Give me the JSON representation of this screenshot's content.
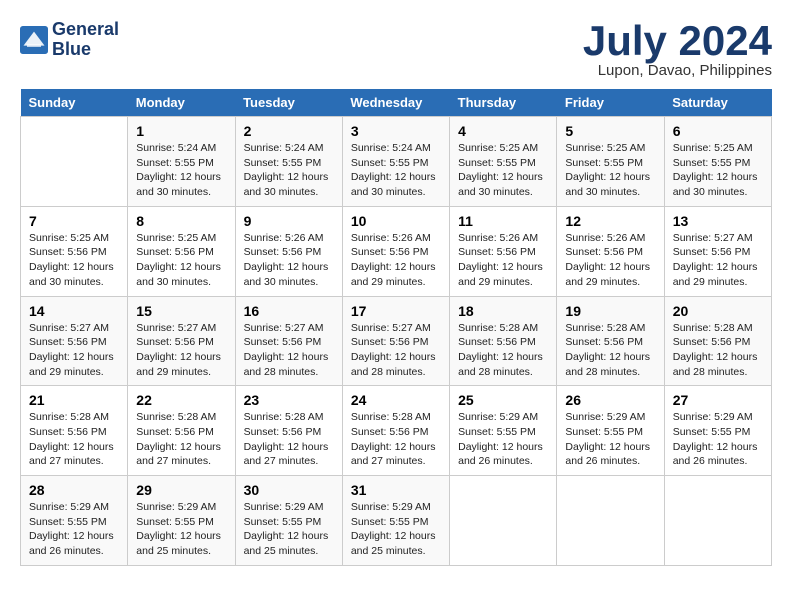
{
  "header": {
    "logo_line1": "General",
    "logo_line2": "Blue",
    "month_year": "July 2024",
    "location": "Lupon, Davao, Philippines"
  },
  "weekdays": [
    "Sunday",
    "Monday",
    "Tuesday",
    "Wednesday",
    "Thursday",
    "Friday",
    "Saturday"
  ],
  "weeks": [
    [
      {
        "day": "",
        "info": ""
      },
      {
        "day": "1",
        "info": "Sunrise: 5:24 AM\nSunset: 5:55 PM\nDaylight: 12 hours\nand 30 minutes."
      },
      {
        "day": "2",
        "info": "Sunrise: 5:24 AM\nSunset: 5:55 PM\nDaylight: 12 hours\nand 30 minutes."
      },
      {
        "day": "3",
        "info": "Sunrise: 5:24 AM\nSunset: 5:55 PM\nDaylight: 12 hours\nand 30 minutes."
      },
      {
        "day": "4",
        "info": "Sunrise: 5:25 AM\nSunset: 5:55 PM\nDaylight: 12 hours\nand 30 minutes."
      },
      {
        "day": "5",
        "info": "Sunrise: 5:25 AM\nSunset: 5:55 PM\nDaylight: 12 hours\nand 30 minutes."
      },
      {
        "day": "6",
        "info": "Sunrise: 5:25 AM\nSunset: 5:55 PM\nDaylight: 12 hours\nand 30 minutes."
      }
    ],
    [
      {
        "day": "7",
        "info": "Sunrise: 5:25 AM\nSunset: 5:56 PM\nDaylight: 12 hours\nand 30 minutes."
      },
      {
        "day": "8",
        "info": "Sunrise: 5:25 AM\nSunset: 5:56 PM\nDaylight: 12 hours\nand 30 minutes."
      },
      {
        "day": "9",
        "info": "Sunrise: 5:26 AM\nSunset: 5:56 PM\nDaylight: 12 hours\nand 30 minutes."
      },
      {
        "day": "10",
        "info": "Sunrise: 5:26 AM\nSunset: 5:56 PM\nDaylight: 12 hours\nand 29 minutes."
      },
      {
        "day": "11",
        "info": "Sunrise: 5:26 AM\nSunset: 5:56 PM\nDaylight: 12 hours\nand 29 minutes."
      },
      {
        "day": "12",
        "info": "Sunrise: 5:26 AM\nSunset: 5:56 PM\nDaylight: 12 hours\nand 29 minutes."
      },
      {
        "day": "13",
        "info": "Sunrise: 5:27 AM\nSunset: 5:56 PM\nDaylight: 12 hours\nand 29 minutes."
      }
    ],
    [
      {
        "day": "14",
        "info": "Sunrise: 5:27 AM\nSunset: 5:56 PM\nDaylight: 12 hours\nand 29 minutes."
      },
      {
        "day": "15",
        "info": "Sunrise: 5:27 AM\nSunset: 5:56 PM\nDaylight: 12 hours\nand 29 minutes."
      },
      {
        "day": "16",
        "info": "Sunrise: 5:27 AM\nSunset: 5:56 PM\nDaylight: 12 hours\nand 28 minutes."
      },
      {
        "day": "17",
        "info": "Sunrise: 5:27 AM\nSunset: 5:56 PM\nDaylight: 12 hours\nand 28 minutes."
      },
      {
        "day": "18",
        "info": "Sunrise: 5:28 AM\nSunset: 5:56 PM\nDaylight: 12 hours\nand 28 minutes."
      },
      {
        "day": "19",
        "info": "Sunrise: 5:28 AM\nSunset: 5:56 PM\nDaylight: 12 hours\nand 28 minutes."
      },
      {
        "day": "20",
        "info": "Sunrise: 5:28 AM\nSunset: 5:56 PM\nDaylight: 12 hours\nand 28 minutes."
      }
    ],
    [
      {
        "day": "21",
        "info": "Sunrise: 5:28 AM\nSunset: 5:56 PM\nDaylight: 12 hours\nand 27 minutes."
      },
      {
        "day": "22",
        "info": "Sunrise: 5:28 AM\nSunset: 5:56 PM\nDaylight: 12 hours\nand 27 minutes."
      },
      {
        "day": "23",
        "info": "Sunrise: 5:28 AM\nSunset: 5:56 PM\nDaylight: 12 hours\nand 27 minutes."
      },
      {
        "day": "24",
        "info": "Sunrise: 5:28 AM\nSunset: 5:56 PM\nDaylight: 12 hours\nand 27 minutes."
      },
      {
        "day": "25",
        "info": "Sunrise: 5:29 AM\nSunset: 5:55 PM\nDaylight: 12 hours\nand 26 minutes."
      },
      {
        "day": "26",
        "info": "Sunrise: 5:29 AM\nSunset: 5:55 PM\nDaylight: 12 hours\nand 26 minutes."
      },
      {
        "day": "27",
        "info": "Sunrise: 5:29 AM\nSunset: 5:55 PM\nDaylight: 12 hours\nand 26 minutes."
      }
    ],
    [
      {
        "day": "28",
        "info": "Sunrise: 5:29 AM\nSunset: 5:55 PM\nDaylight: 12 hours\nand 26 minutes."
      },
      {
        "day": "29",
        "info": "Sunrise: 5:29 AM\nSunset: 5:55 PM\nDaylight: 12 hours\nand 25 minutes."
      },
      {
        "day": "30",
        "info": "Sunrise: 5:29 AM\nSunset: 5:55 PM\nDaylight: 12 hours\nand 25 minutes."
      },
      {
        "day": "31",
        "info": "Sunrise: 5:29 AM\nSunset: 5:55 PM\nDaylight: 12 hours\nand 25 minutes."
      },
      {
        "day": "",
        "info": ""
      },
      {
        "day": "",
        "info": ""
      },
      {
        "day": "",
        "info": ""
      }
    ]
  ]
}
